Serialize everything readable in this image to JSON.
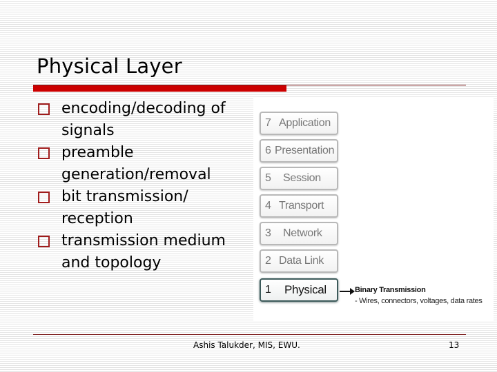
{
  "slide": {
    "title": "Physical Layer",
    "bullets": [
      {
        "line1": "encoding/decoding of",
        "line2": "signals"
      },
      {
        "line1": "preamble",
        "line2": "generation/removal"
      },
      {
        "line1": "bit transmission/",
        "line2": "reception"
      },
      {
        "line1": "transmission medium",
        "line2": "and topology"
      }
    ],
    "bullet_icon": "hollow-square-bullet",
    "figure": {
      "layers": [
        {
          "num": "7",
          "name": "Application"
        },
        {
          "num": "6",
          "name": "Presentation"
        },
        {
          "num": "5",
          "name": "Session"
        },
        {
          "num": "4",
          "name": "Transport"
        },
        {
          "num": "3",
          "name": "Network"
        },
        {
          "num": "2",
          "name": "Data Link"
        },
        {
          "num": "1",
          "name": "Physical"
        }
      ],
      "highlighted_layer": "Physical",
      "annotation_title": "Binary Transmission",
      "annotation_detail": "- Wires, connectors, voltages, data rates"
    },
    "footer": "Ashis Talukder, MIS, EWU.",
    "page_number": "13"
  },
  "colors": {
    "accent_red": "#cc0000",
    "rule_dark_red": "#7a1a1a",
    "bullet_red": "#a01c1c"
  }
}
